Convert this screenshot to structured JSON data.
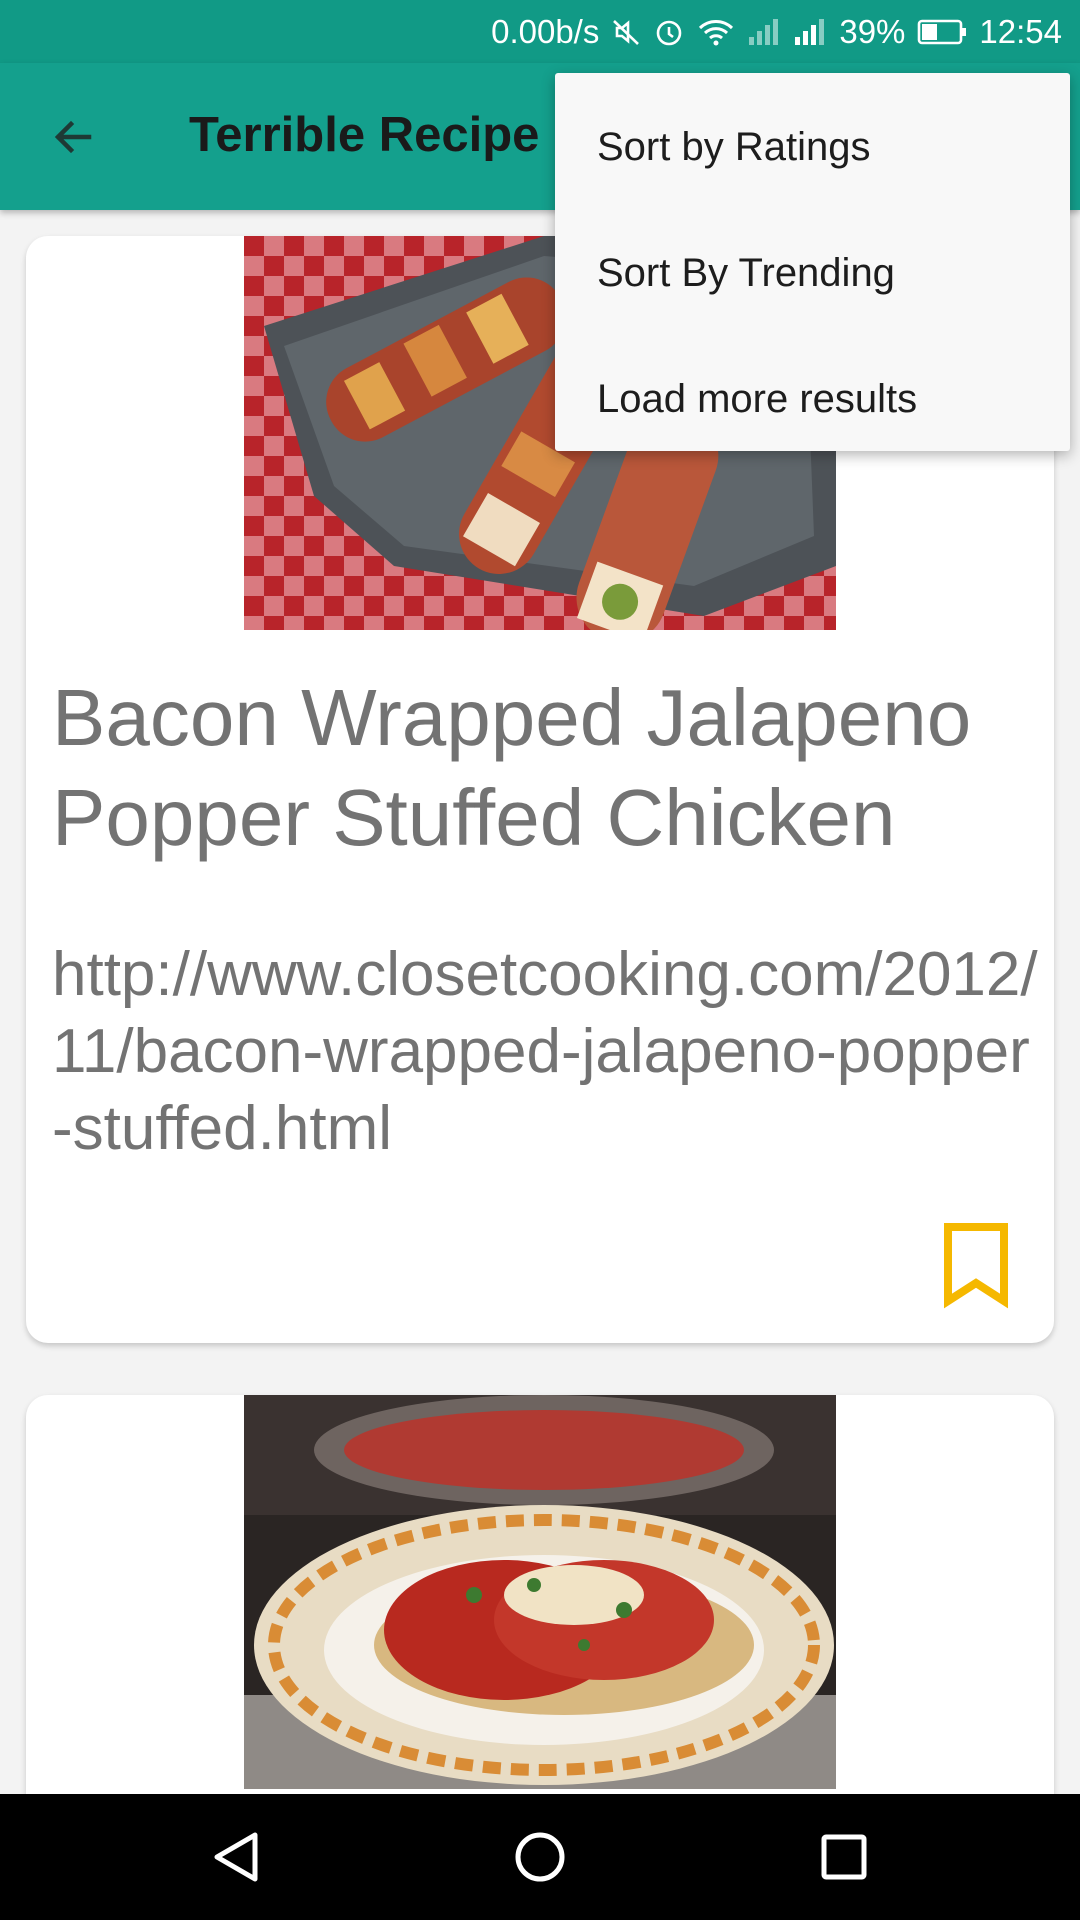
{
  "status_bar": {
    "net_speed": "0.00b/s",
    "battery": "39%",
    "time": "12:54",
    "icons": [
      "mute-icon",
      "alarm-icon",
      "wifi-icon",
      "signal-icon",
      "signal-icon",
      "battery-icon"
    ]
  },
  "app_bar": {
    "title": "Terrible Recipe",
    "back_icon": "arrow-back-icon",
    "color": "#14a08d"
  },
  "menu": {
    "items": [
      {
        "label": "Sort by Ratings"
      },
      {
        "label": "Sort By Trending"
      },
      {
        "label": "Load more results"
      }
    ]
  },
  "recipes": [
    {
      "title": "Bacon Wrapped Jalapeno Popper Stuffed Chicken",
      "url": "http://www.closetcooking.com/2012/11/bacon-wrapped-jalapeno-popper-stuffed.html",
      "image": "bacon-wrapped-chicken-photo",
      "bookmark_color": "#f5b800"
    },
    {
      "title": "",
      "url": "",
      "image": "chicken-parmesan-spaghetti-photo"
    }
  ],
  "nav_bar": {
    "icons": [
      "nav-back-icon",
      "nav-home-icon",
      "nav-recents-icon"
    ]
  }
}
